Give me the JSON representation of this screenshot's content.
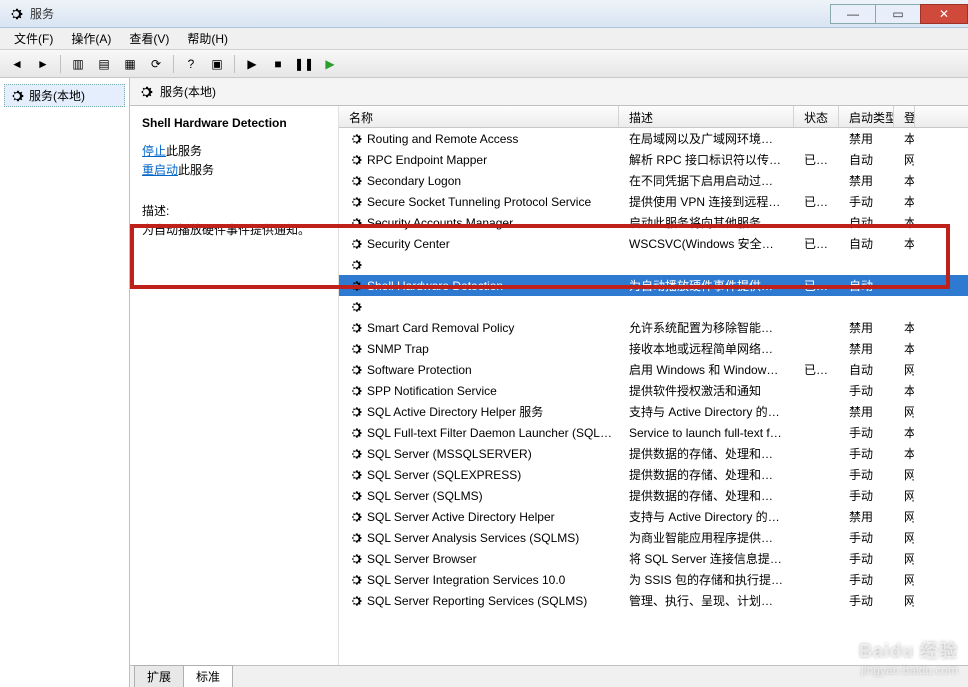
{
  "window": {
    "title": "服务"
  },
  "menubar": {
    "file": "文件(F)",
    "action": "操作(A)",
    "view": "查看(V)",
    "help": "帮助(H)"
  },
  "tree": {
    "root": "服务(本地)"
  },
  "header": {
    "title": "服务(本地)"
  },
  "details": {
    "selected_name": "Shell Hardware Detection",
    "stop_prefix": "停止",
    "stop_suffix": "此服务",
    "restart_prefix": "重启动",
    "restart_suffix": "此服务",
    "desc_label": "描述:",
    "desc_value": "为自动播放硬件事件提供通知。"
  },
  "columns": {
    "name": "名称",
    "desc": "描述",
    "status": "状态",
    "startup": "启动类型",
    "logon": "登"
  },
  "tabs": {
    "ext": "扩展",
    "std": "标准"
  },
  "services": [
    {
      "name": "Routing and Remote Access",
      "desc": "在局域网以及广域网环境中为…",
      "status": "",
      "startup": "禁用",
      "logon": "本"
    },
    {
      "name": "RPC Endpoint Mapper",
      "desc": "解析 RPC 接口标识符以传输…",
      "status": "已启动",
      "startup": "自动",
      "logon": "网"
    },
    {
      "name": "Secondary Logon",
      "desc": "在不同凭据下启用启动过程。…",
      "status": "",
      "startup": "禁用",
      "logon": "本"
    },
    {
      "name": "Secure Socket Tunneling Protocol Service",
      "desc": "提供使用 VPN 连接到远程计…",
      "status": "已启动",
      "startup": "手动",
      "logon": "本"
    },
    {
      "name": "Security Accounts Manager",
      "desc": "启动此服务将向其他服务发出…",
      "status": "",
      "startup": "自动",
      "logon": "本"
    },
    {
      "name": "Security Center",
      "desc": "WSCSVC(Windows 安全中心…",
      "status": "已启动",
      "startup": "自动",
      "logon": "本"
    },
    {
      "name": "",
      "desc": "",
      "status": "",
      "startup": "",
      "logon": ""
    },
    {
      "name": "Shell Hardware Detection",
      "desc": "为自动播放硬件事件提供通知。",
      "status": "已启动",
      "startup": "自动",
      "logon": "",
      "selected": true
    },
    {
      "name": "",
      "desc": "",
      "status": "",
      "startup": "",
      "logon": ""
    },
    {
      "name": "Smart Card Removal Policy",
      "desc": "允许系统配置为移除智能卡时…",
      "status": "",
      "startup": "禁用",
      "logon": "本"
    },
    {
      "name": "SNMP Trap",
      "desc": "接收本地或远程简单网络管理…",
      "status": "",
      "startup": "禁用",
      "logon": "本"
    },
    {
      "name": "Software Protection",
      "desc": "启用 Windows 和 Windows …",
      "status": "已启动",
      "startup": "自动",
      "logon": "网"
    },
    {
      "name": "SPP Notification Service",
      "desc": "提供软件授权激活和通知",
      "status": "",
      "startup": "手动",
      "logon": "本"
    },
    {
      "name": "SQL Active Directory Helper 服务",
      "desc": "支持与 Active Directory 的集成",
      "status": "",
      "startup": "禁用",
      "logon": "网"
    },
    {
      "name": "SQL Full-text Filter Daemon Launcher (SQL…",
      "desc": "Service to launch full-text fil…",
      "status": "",
      "startup": "手动",
      "logon": "本"
    },
    {
      "name": "SQL Server (MSSQLSERVER)",
      "desc": "提供数据的存储、处理和受控…",
      "status": "",
      "startup": "手动",
      "logon": "本"
    },
    {
      "name": "SQL Server (SQLEXPRESS)",
      "desc": "提供数据的存储、处理和受控…",
      "status": "",
      "startup": "手动",
      "logon": "网"
    },
    {
      "name": "SQL Server (SQLMS)",
      "desc": "提供数据的存储、处理和受控…",
      "status": "",
      "startup": "手动",
      "logon": "网"
    },
    {
      "name": "SQL Server Active Directory Helper",
      "desc": "支持与 Active Directory 的集…",
      "status": "",
      "startup": "禁用",
      "logon": "网"
    },
    {
      "name": "SQL Server Analysis Services (SQLMS)",
      "desc": "为商业智能应用程序提供联机…",
      "status": "",
      "startup": "手动",
      "logon": "网"
    },
    {
      "name": "SQL Server Browser",
      "desc": "将 SQL Server 连接信息提供…",
      "status": "",
      "startup": "手动",
      "logon": "网"
    },
    {
      "name": "SQL Server Integration Services 10.0",
      "desc": "为 SSIS 包的存储和执行提供…",
      "status": "",
      "startup": "手动",
      "logon": "网"
    },
    {
      "name": "SQL Server Reporting Services (SQLMS)",
      "desc": "管理、执行、呈现、计划和传…",
      "status": "",
      "startup": "手动",
      "logon": "网"
    }
  ],
  "watermark": {
    "brand": "Baidu 经验",
    "url": "jingyan.baidu.com"
  },
  "highlight_box": {
    "top_row_index": 6,
    "rows": 3
  }
}
